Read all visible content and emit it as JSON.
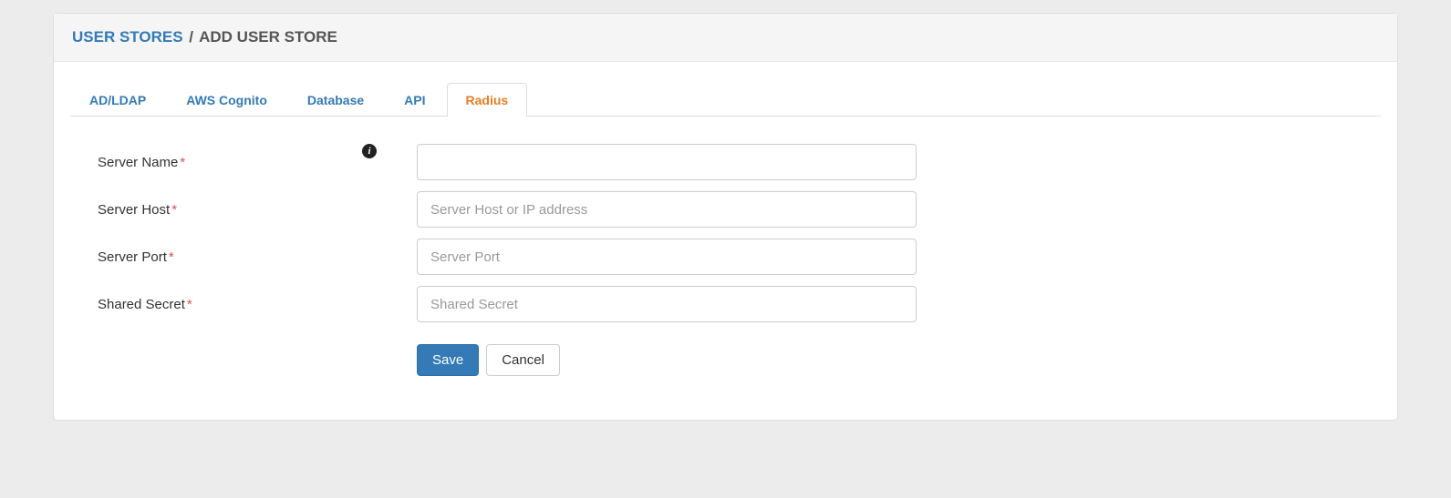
{
  "breadcrumb": {
    "link": "USER STORES",
    "sep": "/",
    "current": "ADD USER STORE"
  },
  "tabs": {
    "t0": "AD/LDAP",
    "t1": "AWS Cognito",
    "t2": "Database",
    "t3": "API",
    "t4": "Radius"
  },
  "form": {
    "server_name": {
      "label": "Server Name",
      "required": "*",
      "value": "",
      "placeholder": ""
    },
    "server_host": {
      "label": "Server Host",
      "required": "*",
      "value": "",
      "placeholder": "Server Host or IP address"
    },
    "server_port": {
      "label": "Server Port",
      "required": "*",
      "value": "",
      "placeholder": "Server Port"
    },
    "shared_secret": {
      "label": "Shared Secret",
      "required": "*",
      "value": "",
      "placeholder": "Shared Secret"
    }
  },
  "buttons": {
    "save": "Save",
    "cancel": "Cancel"
  },
  "info_glyph": "i"
}
